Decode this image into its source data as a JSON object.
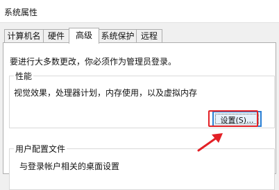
{
  "window": {
    "title": "系统属性"
  },
  "tabs": [
    {
      "label": "计算机名"
    },
    {
      "label": "硬件"
    },
    {
      "label": "高级"
    },
    {
      "label": "系统保护"
    },
    {
      "label": "远程"
    }
  ],
  "advanced": {
    "admin_note": "要进行大多数更改，你必须作为管理员登录。",
    "performance": {
      "title": "性能",
      "description": "视觉效果，处理器计划，内存使用，以及虚拟内存",
      "settings_button": "设置(S)..."
    },
    "user_profiles": {
      "title": "用户配置文件",
      "description": "与登录帐户相关的桌面设置"
    }
  },
  "colors": {
    "highlight_box": "#e32026",
    "focus_border": "#2a7fd4",
    "annotation_arrow": "#e32026"
  }
}
